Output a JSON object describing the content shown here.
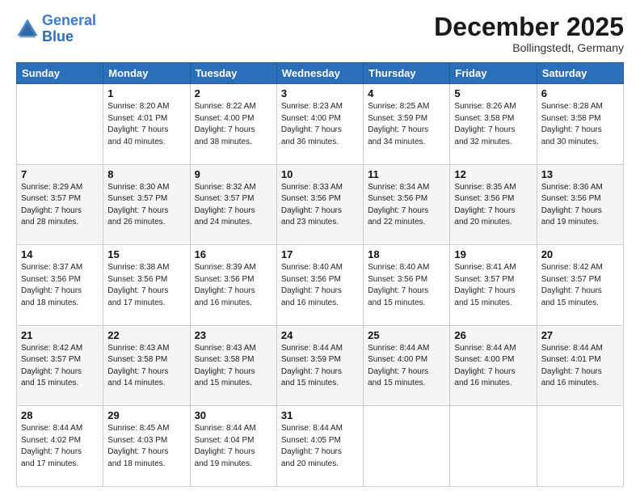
{
  "logo": {
    "line1": "General",
    "line2": "Blue"
  },
  "header": {
    "month": "December 2025",
    "location": "Bollingstedt, Germany"
  },
  "weekdays": [
    "Sunday",
    "Monday",
    "Tuesday",
    "Wednesday",
    "Thursday",
    "Friday",
    "Saturday"
  ],
  "weeks": [
    [
      {
        "day": "",
        "info": ""
      },
      {
        "day": "1",
        "info": "Sunrise: 8:20 AM\nSunset: 4:01 PM\nDaylight: 7 hours\nand 40 minutes."
      },
      {
        "day": "2",
        "info": "Sunrise: 8:22 AM\nSunset: 4:00 PM\nDaylight: 7 hours\nand 38 minutes."
      },
      {
        "day": "3",
        "info": "Sunrise: 8:23 AM\nSunset: 4:00 PM\nDaylight: 7 hours\nand 36 minutes."
      },
      {
        "day": "4",
        "info": "Sunrise: 8:25 AM\nSunset: 3:59 PM\nDaylight: 7 hours\nand 34 minutes."
      },
      {
        "day": "5",
        "info": "Sunrise: 8:26 AM\nSunset: 3:58 PM\nDaylight: 7 hours\nand 32 minutes."
      },
      {
        "day": "6",
        "info": "Sunrise: 8:28 AM\nSunset: 3:58 PM\nDaylight: 7 hours\nand 30 minutes."
      }
    ],
    [
      {
        "day": "7",
        "info": "Sunrise: 8:29 AM\nSunset: 3:57 PM\nDaylight: 7 hours\nand 28 minutes."
      },
      {
        "day": "8",
        "info": "Sunrise: 8:30 AM\nSunset: 3:57 PM\nDaylight: 7 hours\nand 26 minutes."
      },
      {
        "day": "9",
        "info": "Sunrise: 8:32 AM\nSunset: 3:57 PM\nDaylight: 7 hours\nand 24 minutes."
      },
      {
        "day": "10",
        "info": "Sunrise: 8:33 AM\nSunset: 3:56 PM\nDaylight: 7 hours\nand 23 minutes."
      },
      {
        "day": "11",
        "info": "Sunrise: 8:34 AM\nSunset: 3:56 PM\nDaylight: 7 hours\nand 22 minutes."
      },
      {
        "day": "12",
        "info": "Sunrise: 8:35 AM\nSunset: 3:56 PM\nDaylight: 7 hours\nand 20 minutes."
      },
      {
        "day": "13",
        "info": "Sunrise: 8:36 AM\nSunset: 3:56 PM\nDaylight: 7 hours\nand 19 minutes."
      }
    ],
    [
      {
        "day": "14",
        "info": "Sunrise: 8:37 AM\nSunset: 3:56 PM\nDaylight: 7 hours\nand 18 minutes."
      },
      {
        "day": "15",
        "info": "Sunrise: 8:38 AM\nSunset: 3:56 PM\nDaylight: 7 hours\nand 17 minutes."
      },
      {
        "day": "16",
        "info": "Sunrise: 8:39 AM\nSunset: 3:56 PM\nDaylight: 7 hours\nand 16 minutes."
      },
      {
        "day": "17",
        "info": "Sunrise: 8:40 AM\nSunset: 3:56 PM\nDaylight: 7 hours\nand 16 minutes."
      },
      {
        "day": "18",
        "info": "Sunrise: 8:40 AM\nSunset: 3:56 PM\nDaylight: 7 hours\nand 15 minutes."
      },
      {
        "day": "19",
        "info": "Sunrise: 8:41 AM\nSunset: 3:57 PM\nDaylight: 7 hours\nand 15 minutes."
      },
      {
        "day": "20",
        "info": "Sunrise: 8:42 AM\nSunset: 3:57 PM\nDaylight: 7 hours\nand 15 minutes."
      }
    ],
    [
      {
        "day": "21",
        "info": "Sunrise: 8:42 AM\nSunset: 3:57 PM\nDaylight: 7 hours\nand 15 minutes."
      },
      {
        "day": "22",
        "info": "Sunrise: 8:43 AM\nSunset: 3:58 PM\nDaylight: 7 hours\nand 14 minutes."
      },
      {
        "day": "23",
        "info": "Sunrise: 8:43 AM\nSunset: 3:58 PM\nDaylight: 7 hours\nand 15 minutes."
      },
      {
        "day": "24",
        "info": "Sunrise: 8:44 AM\nSunset: 3:59 PM\nDaylight: 7 hours\nand 15 minutes."
      },
      {
        "day": "25",
        "info": "Sunrise: 8:44 AM\nSunset: 4:00 PM\nDaylight: 7 hours\nand 15 minutes."
      },
      {
        "day": "26",
        "info": "Sunrise: 8:44 AM\nSunset: 4:00 PM\nDaylight: 7 hours\nand 16 minutes."
      },
      {
        "day": "27",
        "info": "Sunrise: 8:44 AM\nSunset: 4:01 PM\nDaylight: 7 hours\nand 16 minutes."
      }
    ],
    [
      {
        "day": "28",
        "info": "Sunrise: 8:44 AM\nSunset: 4:02 PM\nDaylight: 7 hours\nand 17 minutes."
      },
      {
        "day": "29",
        "info": "Sunrise: 8:45 AM\nSunset: 4:03 PM\nDaylight: 7 hours\nand 18 minutes."
      },
      {
        "day": "30",
        "info": "Sunrise: 8:44 AM\nSunset: 4:04 PM\nDaylight: 7 hours\nand 19 minutes."
      },
      {
        "day": "31",
        "info": "Sunrise: 8:44 AM\nSunset: 4:05 PM\nDaylight: 7 hours\nand 20 minutes."
      },
      {
        "day": "",
        "info": ""
      },
      {
        "day": "",
        "info": ""
      },
      {
        "day": "",
        "info": ""
      }
    ]
  ]
}
